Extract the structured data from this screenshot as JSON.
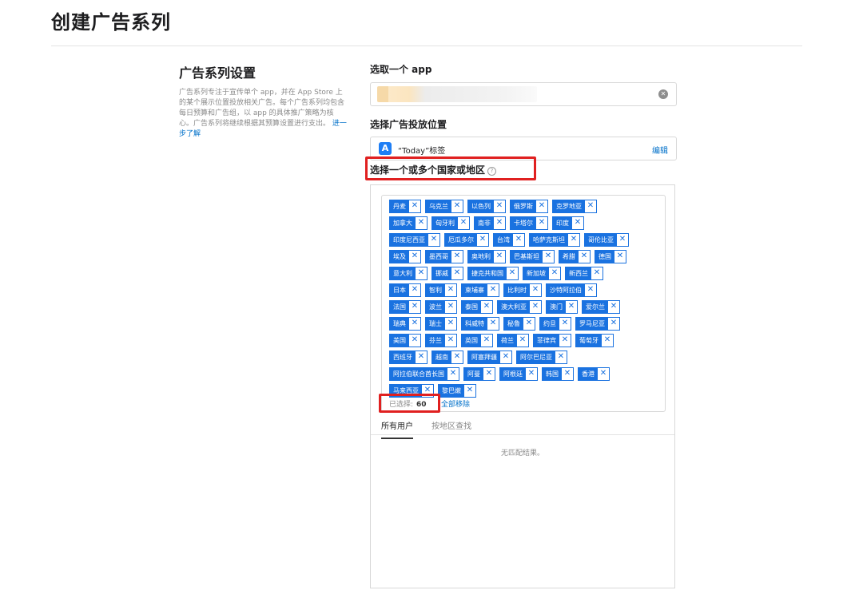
{
  "page": {
    "title": "创建广告系列"
  },
  "campaign_settings": {
    "title": "广告系列设置",
    "description": "广告系列专注于宣传单个 app，并在 App Store 上的某个展示位置投放相关广告。每个广告系列均包含每日预算和广告组，以 app 的具体推广策略为核心。广告系列将继续根据其预算设置进行支出。",
    "learn_more": "进一步了解"
  },
  "app_select": {
    "label": "选取一个 app",
    "clear_icon": "clear-icon"
  },
  "placement": {
    "label": "选择广告投放位置",
    "value": "“Today”标签",
    "icon": "app-store-icon",
    "edit_label": "编辑"
  },
  "countries": {
    "label": "选择一个或多个国家或地区",
    "rows": [
      [
        "丹麦",
        "乌克兰",
        "以色列",
        "俄罗斯",
        "克罗地亚"
      ],
      [
        "加拿大",
        "匈牙利",
        "南非",
        "卡塔尔",
        "印度"
      ],
      [
        "印度尼西亚",
        "厄瓜多尔",
        "台湾",
        "哈萨克斯坦",
        "哥伦比亚"
      ],
      [
        "埃及",
        "墨西哥",
        "奥地利",
        "巴基斯坦",
        "希腊",
        "德国"
      ],
      [
        "意大利",
        "挪威",
        "捷克共和国",
        "新加坡",
        "新西兰"
      ],
      [
        "日本",
        "智利",
        "柬埔寨",
        "比利时",
        "沙特阿拉伯"
      ],
      [
        "法国",
        "波兰",
        "泰国",
        "澳大利亚",
        "澳门",
        "爱尔兰"
      ],
      [
        "瑞典",
        "瑞士",
        "科威特",
        "秘鲁",
        "约旦",
        "罗马尼亚"
      ],
      [
        "美国",
        "芬兰",
        "英国",
        "荷兰",
        "菲律宾",
        "葡萄牙"
      ],
      [
        "西班牙",
        "越南",
        "阿塞拜疆",
        "阿尔巴尼亚"
      ],
      [
        "阿拉伯联合酋长国",
        "阿曼",
        "阿根廷",
        "韩国",
        "香港"
      ],
      [
        "马来西亚",
        "黎巴嫩"
      ]
    ],
    "selected_label": "已选择:",
    "selected_count": "60",
    "remove_all": "全部移除",
    "tabs": [
      "所有用户",
      "按地区查找"
    ],
    "empty_text": "无匹配结果。"
  }
}
